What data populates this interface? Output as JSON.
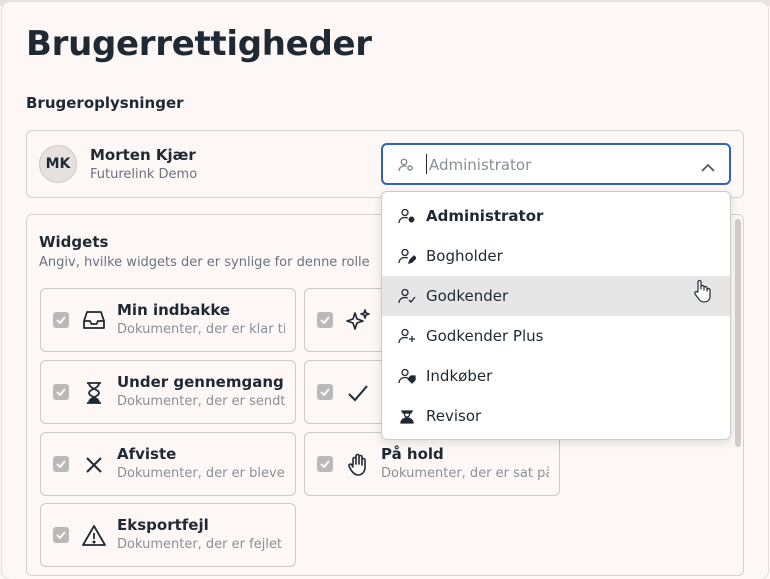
{
  "page": {
    "title": "Brugerrettigheder"
  },
  "user_info": {
    "section_label": "Brugeroplysninger",
    "avatar_initials": "MK",
    "name": "Morten Kjær",
    "organization": "Futurelink Demo",
    "role_select": {
      "placeholder": "Administrator",
      "icon": "user-gear-icon"
    }
  },
  "widgets": {
    "title": "Widgets",
    "description": "Angiv, hvilke widgets der er synlige for denne rolle",
    "items": [
      {
        "title": "Min indbakke",
        "desc": "Dokumenter, der er klar til behandling",
        "icon": "inbox-icon",
        "checked": true
      },
      {
        "title": "",
        "desc": "",
        "icon": "sparkles-icon",
        "checked": true
      },
      {
        "title": "Under gennemgang",
        "desc": "Dokumenter, der er sendt til gennemgang",
        "icon": "hourglass-icon",
        "checked": true
      },
      {
        "title": "",
        "desc": "",
        "icon": "check-icon",
        "checked": true
      },
      {
        "title": "Afviste",
        "desc": "Dokumenter, der er blevet afvist",
        "icon": "x-icon",
        "checked": true
      },
      {
        "title": "På hold",
        "desc": "Dokumenter, der er sat på hold",
        "icon": "hand-icon",
        "checked": true
      },
      {
        "title": "Eksportfejl",
        "desc": "Dokumenter, der er fejlet ved eksport",
        "icon": "warning-icon",
        "checked": true
      }
    ]
  },
  "role_dropdown": {
    "options": [
      {
        "label": "Administrator",
        "icon": "user-gear-icon",
        "selected": true
      },
      {
        "label": "Bogholder",
        "icon": "user-pen-icon"
      },
      {
        "label": "Godkender",
        "icon": "user-check-icon",
        "hovered": true
      },
      {
        "label": "Godkender Plus",
        "icon": "user-plus-icon"
      },
      {
        "label": "Indkøber",
        "icon": "user-tag-icon"
      },
      {
        "label": "Revisor",
        "icon": "user-tie-icon"
      }
    ]
  },
  "colors": {
    "accent": "#2f62b8",
    "text": "#1f2933",
    "muted": "#6b7280",
    "hover": "#e6e6e6",
    "checkbox": "#b9b9b9"
  }
}
